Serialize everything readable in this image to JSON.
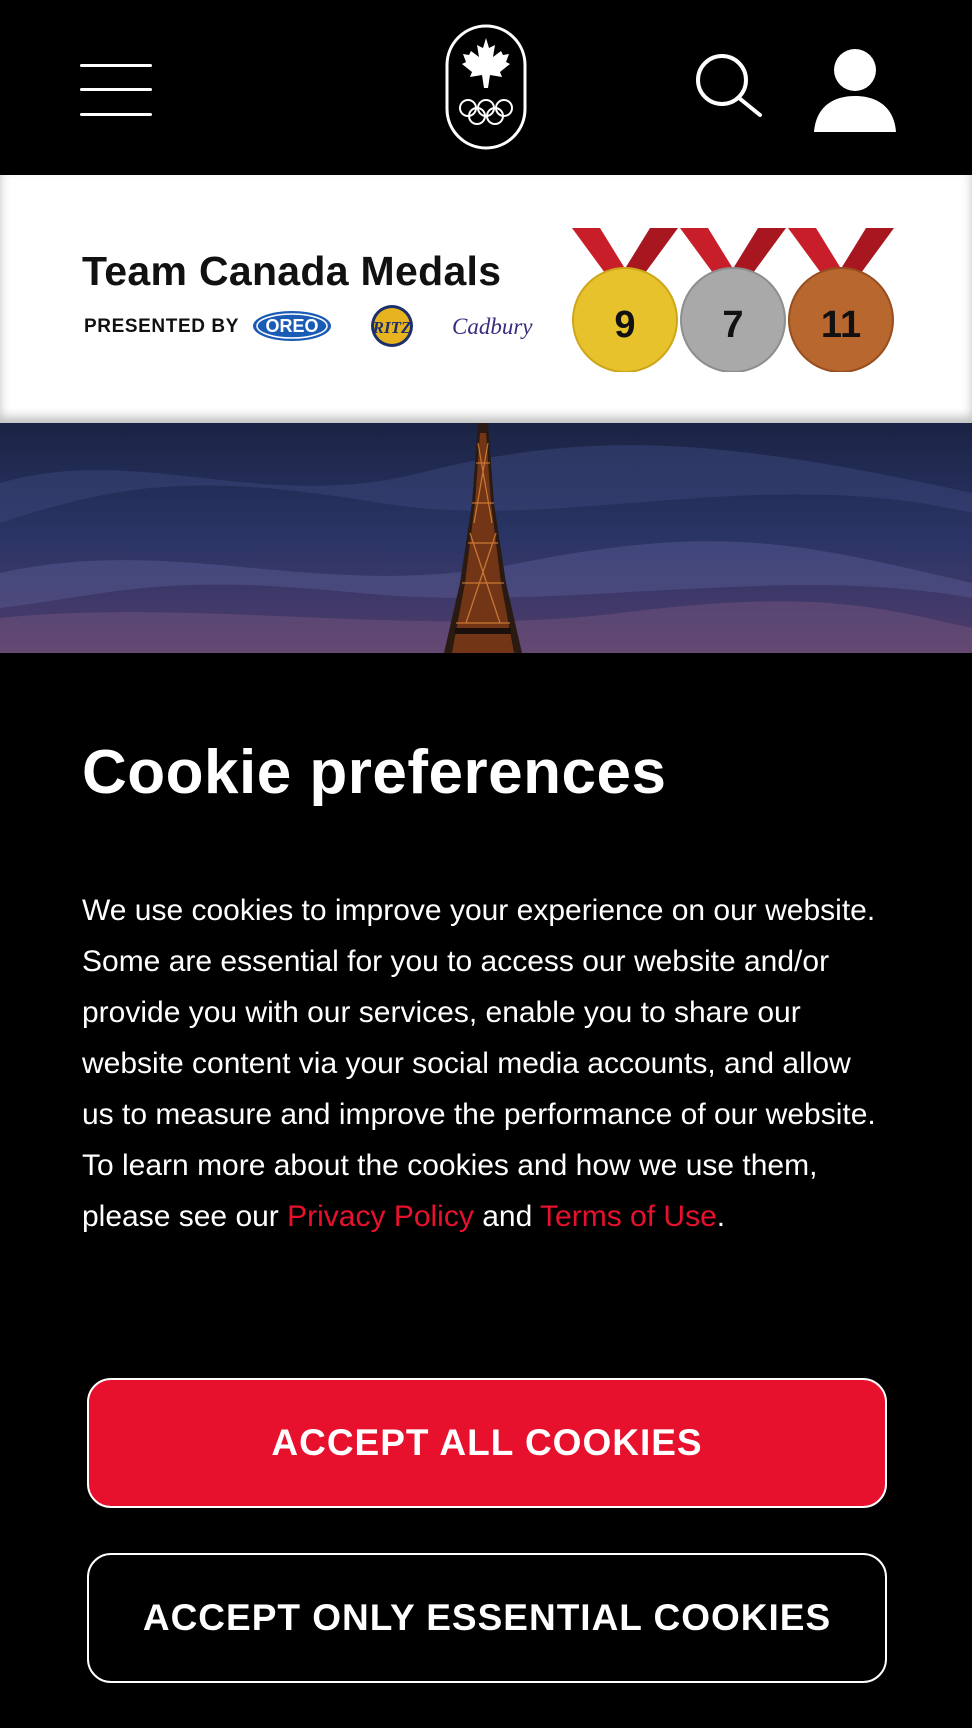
{
  "header": {
    "menu_icon": "hamburger-menu-icon",
    "logo_icon": "maple-leaf-olympic-rings-logo",
    "search_icon": "search-icon",
    "account_icon": "user-account-icon"
  },
  "medals": {
    "title": "Team Canada Medals",
    "presented_by": "PRESENTED BY",
    "sponsors": [
      {
        "name": "OREO"
      },
      {
        "name": "RITZ"
      },
      {
        "name": "Cadbury"
      }
    ],
    "gold": "9",
    "silver": "7",
    "bronze": "11",
    "colors": {
      "gold": "#e8c22d",
      "silver": "#a9a9a9",
      "bronze": "#b8672f",
      "ribbon": "#c81e2a"
    }
  },
  "cookie_banner": {
    "heading": "Cookie preferences",
    "body_text": "We use cookies to improve your experience on our website. Some are essential for you to access our website and/or provide you with our services, enable you to share our website content via your social media accounts, and allow us to measure and improve the performance of our website. To learn more about the cookies and how we use them, please see our ",
    "privacy_link": "Privacy Policy",
    "and_text": " and ",
    "terms_link": "Terms of Use",
    "period": ".",
    "accept_all_label": "ACCEPT ALL COOKIES",
    "accept_essential_label": "ACCEPT ONLY ESSENTIAL COOKIES",
    "accent_color": "#e8112d"
  }
}
